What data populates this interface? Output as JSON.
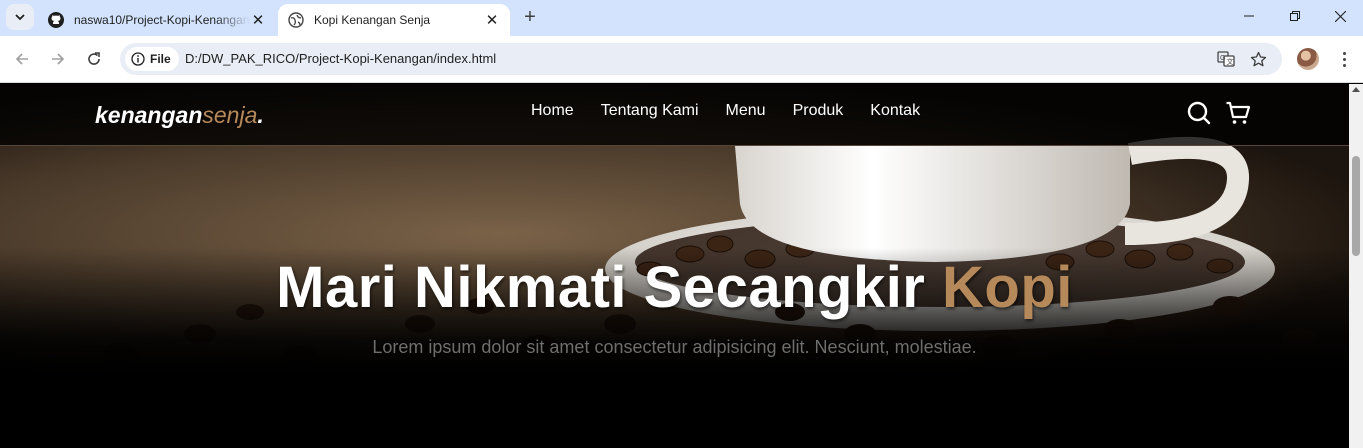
{
  "browser": {
    "tabs": [
      {
        "title": "naswa10/Project-Kopi-Kenangan",
        "favicon": "github-icon",
        "active": false
      },
      {
        "title": "Kopi Kenangan Senja",
        "favicon": "globe-icon",
        "active": true
      }
    ],
    "omnibox": {
      "chip_label": "File",
      "url": "D:/DW_PAK_RICO/Project-Kopi-Kenangan/index.html"
    }
  },
  "site": {
    "logo": {
      "main": "kenangan",
      "accent": "senja",
      "suffix": "."
    },
    "nav": [
      "Home",
      "Tentang Kami",
      "Menu",
      "Produk",
      "Kontak"
    ],
    "hero": {
      "title_main": "Mari Nikmati Secangkir ",
      "title_accent": "Kopi",
      "subtitle": "Lorem ipsum dolor sit amet consectetur adipisicing elit. Nesciunt, molestiae."
    }
  },
  "colors": {
    "tab_strip": "#d3e3fd",
    "accent": "#b6895b"
  }
}
